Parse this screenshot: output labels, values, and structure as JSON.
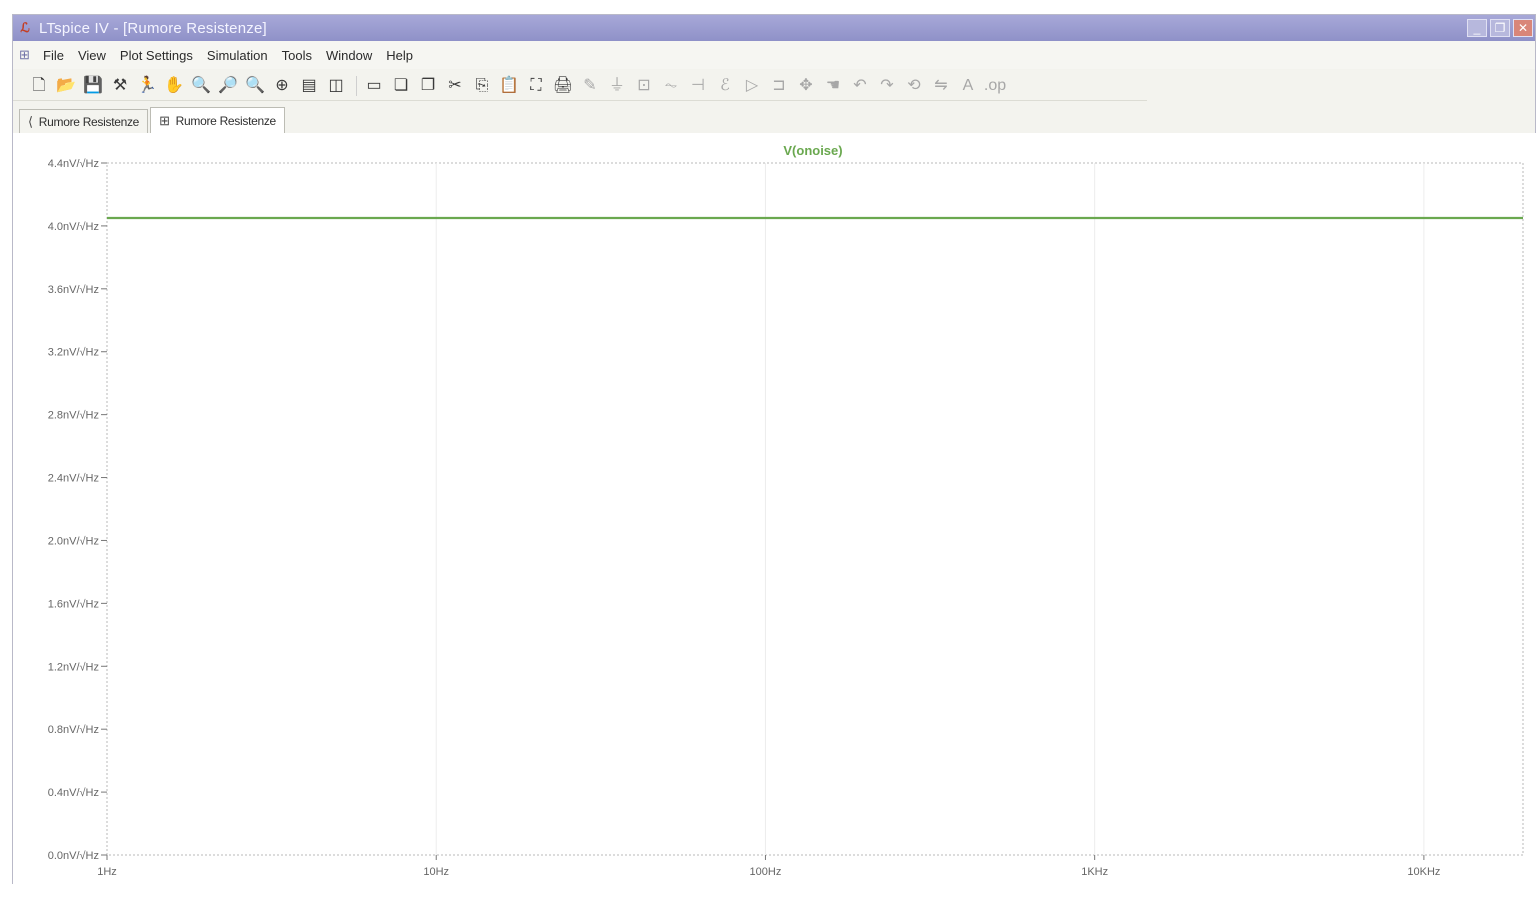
{
  "window": {
    "title": "LTspice IV - [Rumore Resistenze]",
    "controls": [
      "_",
      "❐",
      "✕"
    ]
  },
  "menu": [
    "File",
    "View",
    "Plot Settings",
    "Simulation",
    "Tools",
    "Window",
    "Help"
  ],
  "tabs": [
    {
      "label": "Rumore Resistenze",
      "icon": "schematic-icon"
    },
    {
      "label": "Rumore Resistenze",
      "icon": "waveform-icon"
    }
  ],
  "toolbar_icons": [
    "new-icon",
    "open-icon",
    "save-icon",
    "control-panel-icon",
    "run-icon",
    "halt-icon",
    "zoom-in-icon",
    "pan-icon",
    "zoom-out-icon",
    "zoom-fit-icon",
    "autorange-icon",
    "tile-icon",
    "cascade-icon",
    "close-all-icon",
    "cut-icon",
    "copy-icon",
    "paste-icon",
    "find-icon",
    "print-setup-icon",
    "print-icon",
    "wire-icon",
    "ground-icon",
    "label-icon",
    "resistor-icon",
    "capacitor-icon",
    "inductor-icon",
    "diode-icon",
    "component-icon",
    "move-icon",
    "drag-icon",
    "undo-icon",
    "redo-icon",
    "rotate-icon",
    "mirror-icon",
    "text-icon",
    "spice-directive-icon"
  ],
  "colors": {
    "trace": "#6aa84f",
    "title_bar": "#9a9bd0",
    "grid": "#b8b8b8"
  },
  "chart_data": {
    "type": "line",
    "title": "V(onoise)",
    "xscale": "log",
    "xlim": [
      1,
      20000
    ],
    "ylim": [
      0.0,
      4.4
    ],
    "x_ticks": [
      "1Hz",
      "10Hz",
      "100Hz",
      "1KHz",
      "10KHz"
    ],
    "y_ticks": [
      "4.4nV/√Hz",
      "4.0nV/√Hz",
      "3.6nV/√Hz",
      "3.2nV/√Hz",
      "2.8nV/√Hz",
      "2.4nV/√Hz",
      "2.0nV/√Hz",
      "1.6nV/√Hz",
      "1.2nV/√Hz",
      "0.8nV/√Hz",
      "0.4nV/√Hz",
      "0.0nV/√Hz"
    ],
    "series": [
      {
        "name": "V(onoise)",
        "x": [
          1,
          10,
          100,
          1000,
          10000,
          20000
        ],
        "y": [
          4.05,
          4.05,
          4.05,
          4.05,
          4.05,
          4.05
        ]
      }
    ]
  }
}
